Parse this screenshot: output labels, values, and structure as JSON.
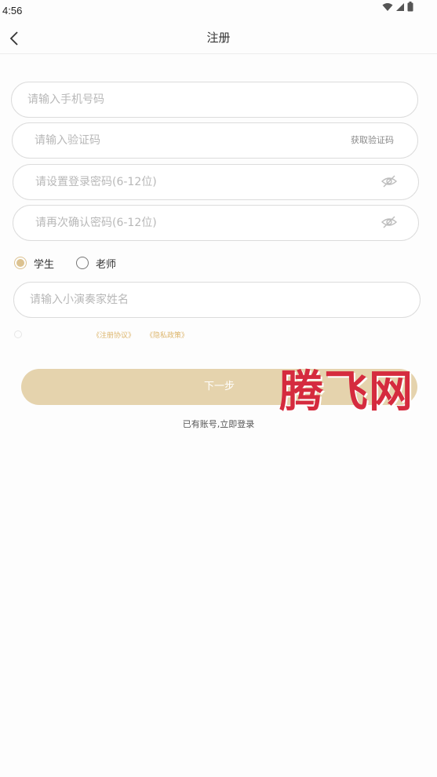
{
  "status_bar": {
    "time": "4:56"
  },
  "nav": {
    "title": "注册"
  },
  "form": {
    "phone_placeholder": "请输入手机号码",
    "code_placeholder": "请输入验证码",
    "get_code_label": "获取验证码",
    "password_placeholder": "请设置登录密码(6-12位)",
    "confirm_placeholder": "请再次确认密码(6-12位)",
    "name_placeholder": "请输入小演奏家姓名"
  },
  "roles": {
    "student": "学生",
    "teacher": "老师",
    "selected": "student"
  },
  "agreement": {
    "register_link": "《注册协议》",
    "privacy_link": "《隐私政策》"
  },
  "actions": {
    "next_label": "下一步",
    "login_label": "已有账号,立即登录"
  },
  "watermark": {
    "text": "腾飞网"
  },
  "colors": {
    "accent": "#dcc290",
    "button": "#e5d3ad",
    "link": "#ddb66d",
    "watermark": "#d52b3e"
  }
}
